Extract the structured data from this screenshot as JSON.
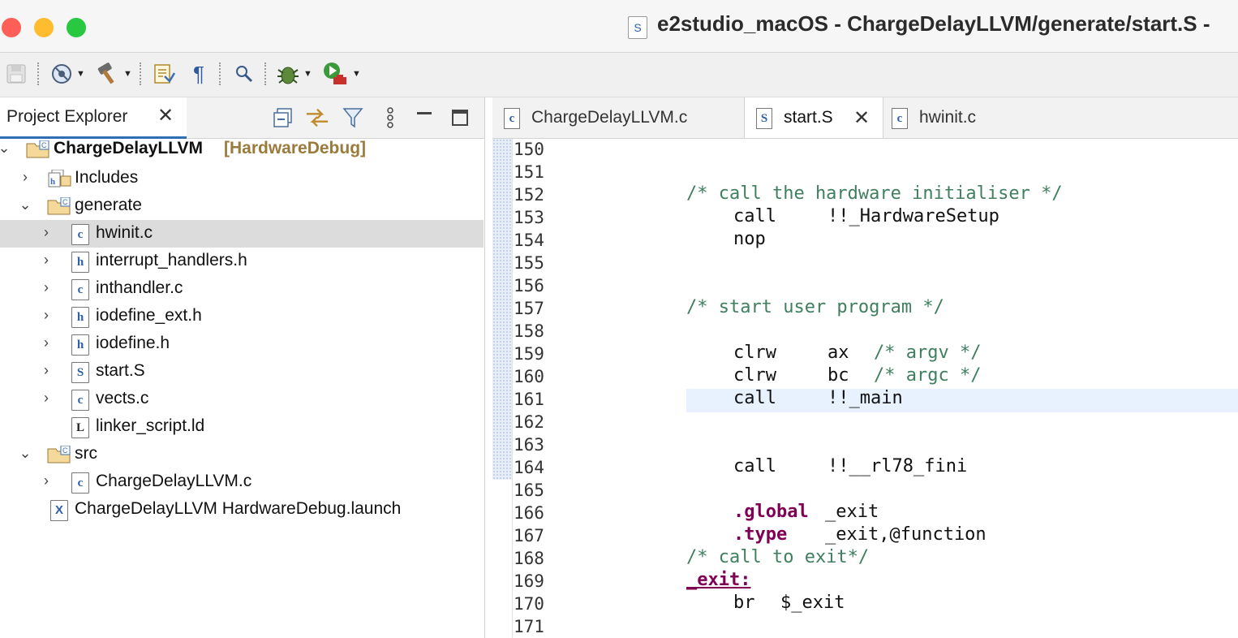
{
  "window": {
    "title": "e2studio_macOS - ChargeDelayLLVM/generate/start.S -",
    "title_icon": "S",
    "traffic_lights": {
      "close": "#fe5f57",
      "minimize": "#febc2e",
      "zoom": "#28c840"
    }
  },
  "toolbar": {
    "items": [
      "save-icon",
      "build-config-icon",
      "build-hammer-icon",
      "toggle-mark-occurrences-icon",
      "show-whitespace-icon",
      "search-icon",
      "debug-bug-icon",
      "run-launch-icon"
    ]
  },
  "project_explorer": {
    "tab_label": "Project Explorer",
    "tree": {
      "project": {
        "name": "ChargeDelayLLVM",
        "config": "[HardwareDebug]"
      },
      "includes": "Includes",
      "generate": "generate",
      "generate_files": [
        "hwinit.c",
        "interrupt_handlers.h",
        "inthandler.c",
        "iodefine_ext.h",
        "iodefine.h",
        "start.S",
        "vects.c",
        "linker_script.ld"
      ],
      "src": "src",
      "src_files": [
        "ChargeDelayLLVM.c"
      ],
      "launch": "ChargeDelayLLVM HardwareDebug.launch"
    },
    "selected": "hwinit.c"
  },
  "editor": {
    "tabs": [
      {
        "label": "ChargeDelayLLVM.c",
        "icon": "c"
      },
      {
        "label": "start.S",
        "icon": "S",
        "active": true
      },
      {
        "label": "hwinit.c",
        "icon": "c"
      }
    ],
    "line_numbers": [
      "150",
      "151",
      "152",
      "153",
      "154",
      "155",
      "156",
      "157",
      "158",
      "159",
      "160",
      "161",
      "162",
      "163",
      "164",
      "165",
      "166",
      "167",
      "168",
      "169",
      "170",
      "171"
    ],
    "code": {
      "l152": "/* call the hardware initialiser */",
      "l153_op": "call",
      "l153_arg": "!!_HardwareSetup",
      "l154": "nop",
      "l157": "/* start user program */",
      "l159_op": "clrw",
      "l159_arg": "ax",
      "l159_cmt": "/* argv */",
      "l160_op": "clrw",
      "l160_arg": "bc",
      "l160_cmt": "/* argc */",
      "l161_op": "call",
      "l161_arg": "!!_main",
      "l164_op": "call",
      "l164_arg": "!!__rl78_fini",
      "l166_kw": ".global",
      "l166_arg": "_exit",
      "l167_kw": ".type",
      "l167_arg": "_exit,@function",
      "l168": "/* call to exit*/",
      "l169": "_exit:",
      "l170_op": "br",
      "l170_arg": "$_exit"
    },
    "current_line": "161"
  }
}
